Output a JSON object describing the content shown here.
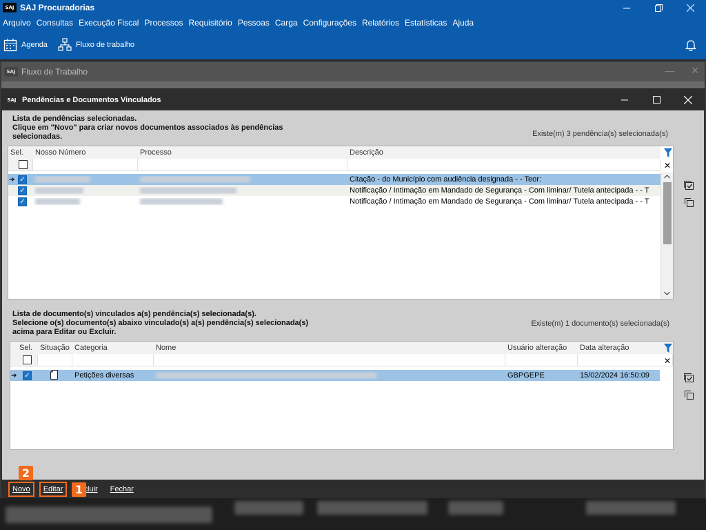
{
  "app": {
    "logo": "SAJ",
    "title": "SAJ Procuradorias"
  },
  "menu": [
    "Arquivo",
    "Consultas",
    "Execução Fiscal",
    "Processos",
    "Requisitório",
    "Pessoas",
    "Carga",
    "Configurações",
    "Relatórios",
    "Estatísticas",
    "Ajuda"
  ],
  "toolbar": {
    "agenda_label": "Agenda",
    "fluxo_label": "Fluxo de trabalho"
  },
  "bg_window": {
    "title": "Fluxo de Trabalho"
  },
  "dialog": {
    "title": "Pendências e Documentos Vinculados",
    "pendencias": {
      "info_line1": "Lista de pendências selecionadas.",
      "info_line2": "Clique em \"Novo\" para criar novos documentos associados às pendências",
      "info_line3": "selecionadas.",
      "count": "Existe(m) 3 pendência(s) selecionada(s)",
      "headers": [
        "Sel.",
        "Nosso Número",
        "Processo",
        "Descrição"
      ],
      "rows": [
        {
          "descricao": "Citação - do Município com audiência designada -  - Teor:"
        },
        {
          "descricao": "Notificação / Intimação em Mandado de Segurança - Com liminar/ Tutela antecipada -  - T"
        },
        {
          "descricao": "Notificação / Intimação em Mandado de Segurança - Com liminar/ Tutela antecipada -  - T"
        }
      ]
    },
    "documentos": {
      "info_line1": "Lista de documento(s) vinculados a(s) pendência(s) selecionada(s).",
      "info_line2": "Selecione o(s) documento(s) abaixo vinculado(s) a(s) pendência(s) selecionada(s)",
      "info_line3": "acima para Editar ou Excluir.",
      "count": "Existe(m) 1 documento(s) selecionada(s)",
      "headers": [
        "Sel.",
        "Situação",
        "Categoria",
        "Nome",
        "Usuário alteração",
        "Data alteração"
      ],
      "rows": [
        {
          "categoria": "Petições diversas",
          "usuario": "GBPGEPE",
          "data": "15/02/2024 16:50:09"
        }
      ]
    },
    "footer": {
      "novo": "Novo",
      "editar": "Editar",
      "excluir_partial": "cluir",
      "fechar": "Fechar"
    },
    "annotations": {
      "badge_novo": "2",
      "badge_editar": "1"
    }
  },
  "colors": {
    "app_blue": "#0b5cad",
    "dark_title": "#2d2d2d",
    "selected_row": "#9cc3e6",
    "highlight": "#f26b1d",
    "checkbox": "#1e74c8"
  }
}
